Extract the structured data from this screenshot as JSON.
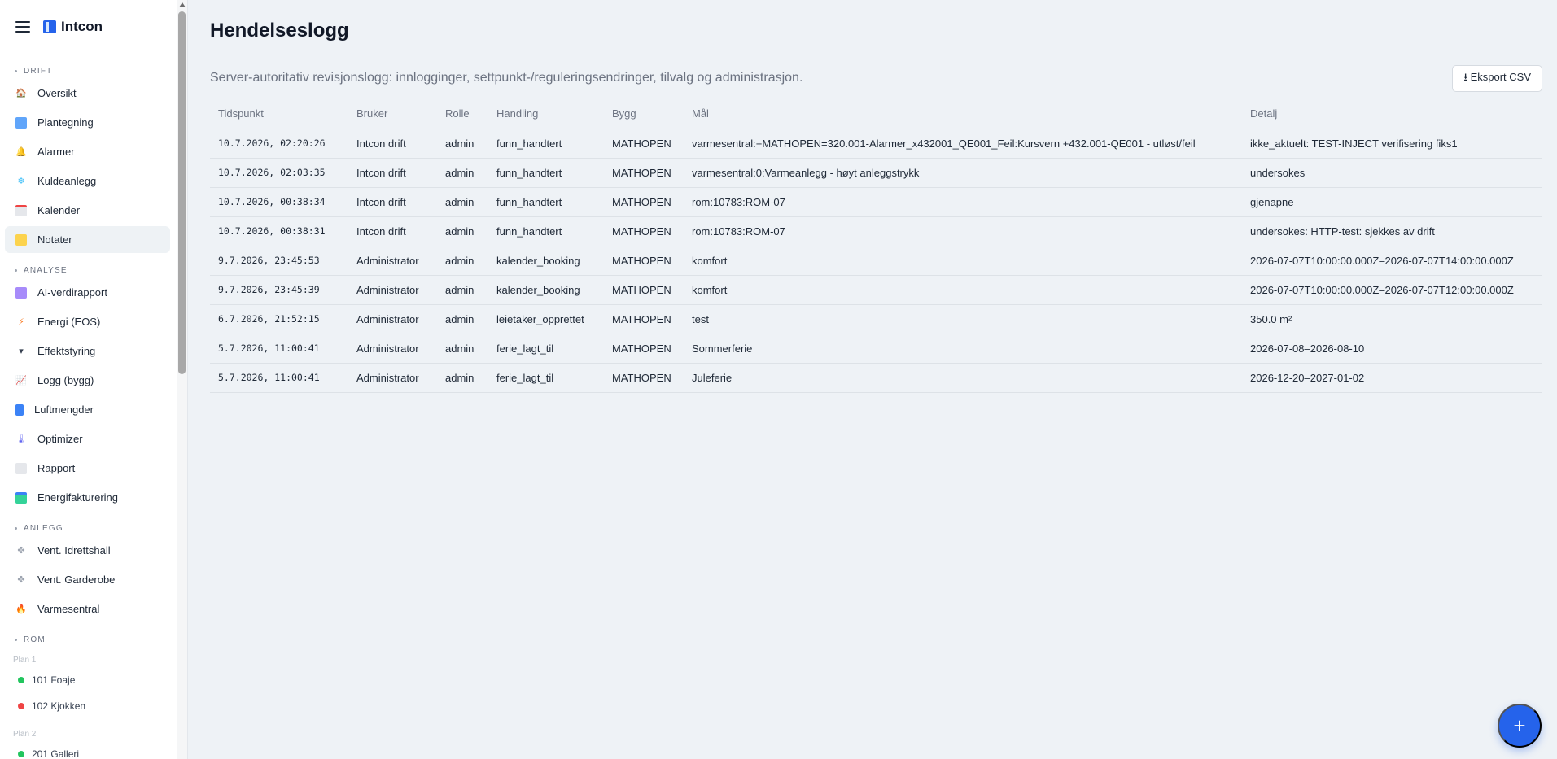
{
  "brand": {
    "name": "Intcon",
    "menu_icon": "hamburger-icon",
    "logo_color": "#2563eb"
  },
  "sidebar": {
    "sections": [
      {
        "label": "DRIFT",
        "items": [
          {
            "label": "Oversikt",
            "icon": "home-icon"
          },
          {
            "label": "Plantegning",
            "icon": "map-icon"
          },
          {
            "label": "Alarmer",
            "icon": "bell-icon"
          },
          {
            "label": "Kuldeanlegg",
            "icon": "snowflake-icon"
          },
          {
            "label": "Kalender",
            "icon": "calendar-icon"
          },
          {
            "label": "Notater",
            "icon": "note-icon",
            "active": true
          }
        ]
      },
      {
        "label": "ANALYSE",
        "items": [
          {
            "label": "AI-verdirapport",
            "icon": "robot-icon"
          },
          {
            "label": "Energi (EOS)",
            "icon": "bolt-icon"
          },
          {
            "label": "Effektstyring",
            "icon": "plug-icon"
          },
          {
            "label": "Logg (bygg)",
            "icon": "chart-icon"
          },
          {
            "label": "Luftmengder",
            "icon": "airflow-icon"
          },
          {
            "label": "Optimizer",
            "icon": "thermometer-icon"
          },
          {
            "label": "Rapport",
            "icon": "document-icon"
          },
          {
            "label": "Energifakturering",
            "icon": "invoice-icon"
          }
        ]
      },
      {
        "label": "ANLEGG",
        "items": [
          {
            "label": "Vent. Idrettshall",
            "icon": "fan-icon"
          },
          {
            "label": "Vent. Garderobe",
            "icon": "fan-icon"
          },
          {
            "label": "Varmesentral",
            "icon": "flame-icon"
          }
        ]
      },
      {
        "label": "ROM",
        "items": []
      }
    ],
    "rooms": {
      "plan1_label": "Plan 1",
      "plan2_label": "Plan 2",
      "plan1": [
        {
          "label": "101 Foaje",
          "status_color": "#22c55e"
        },
        {
          "label": "102 Kjokken",
          "status_color": "#ef4444"
        }
      ],
      "plan2": [
        {
          "label": "201 Galleri",
          "status_color": "#22c55e"
        }
      ]
    }
  },
  "page": {
    "title": "Hendelseslogg",
    "subtitle": "Server-autoritativ revisjonslogg: innlogginger, settpunkt-/reguleringsendringer, tilvalg og administrasjon.",
    "export_label": "⭳ Eksport CSV",
    "fab_label": "+"
  },
  "table": {
    "columns": [
      "Tidspunkt",
      "Bruker",
      "Rolle",
      "Handling",
      "Bygg",
      "Mål",
      "Detalj"
    ],
    "rows": [
      [
        "10.7.2026, 02:20:26",
        "Intcon drift",
        "admin",
        "funn_handtert",
        "MATHOPEN",
        "varmesentral:+MATHOPEN=320.001-Alarmer_x432001_QE001_Feil:Kursvern +432.001-QE001 - utløst/feil",
        "ikke_aktuelt: TEST-INJECT verifisering fiks1"
      ],
      [
        "10.7.2026, 02:03:35",
        "Intcon drift",
        "admin",
        "funn_handtert",
        "MATHOPEN",
        "varmesentral:0:Varmeanlegg - høyt anleggstrykk",
        "undersokes"
      ],
      [
        "10.7.2026, 00:38:34",
        "Intcon drift",
        "admin",
        "funn_handtert",
        "MATHOPEN",
        "rom:10783:ROM-07",
        "gjenapne"
      ],
      [
        "10.7.2026, 00:38:31",
        "Intcon drift",
        "admin",
        "funn_handtert",
        "MATHOPEN",
        "rom:10783:ROM-07",
        "undersokes: HTTP-test: sjekkes av drift"
      ],
      [
        "9.7.2026, 23:45:53",
        "Administrator",
        "admin",
        "kalender_booking",
        "MATHOPEN",
        "komfort",
        "2026-07-07T10:00:00.000Z–2026-07-07T14:00:00.000Z"
      ],
      [
        "9.7.2026, 23:45:39",
        "Administrator",
        "admin",
        "kalender_booking",
        "MATHOPEN",
        "komfort",
        "2026-07-07T10:00:00.000Z–2026-07-07T12:00:00.000Z"
      ],
      [
        "6.7.2026, 21:52:15",
        "Administrator",
        "admin",
        "leietaker_opprettet",
        "MATHOPEN",
        "test",
        "350.0 m²"
      ],
      [
        "5.7.2026, 11:00:41",
        "Administrator",
        "admin",
        "ferie_lagt_til",
        "MATHOPEN",
        "Sommerferie",
        "2026-07-08–2026-08-10"
      ],
      [
        "5.7.2026, 11:00:41",
        "Administrator",
        "admin",
        "ferie_lagt_til",
        "MATHOPEN",
        "Juleferie",
        "2026-12-20–2027-01-02"
      ]
    ]
  }
}
